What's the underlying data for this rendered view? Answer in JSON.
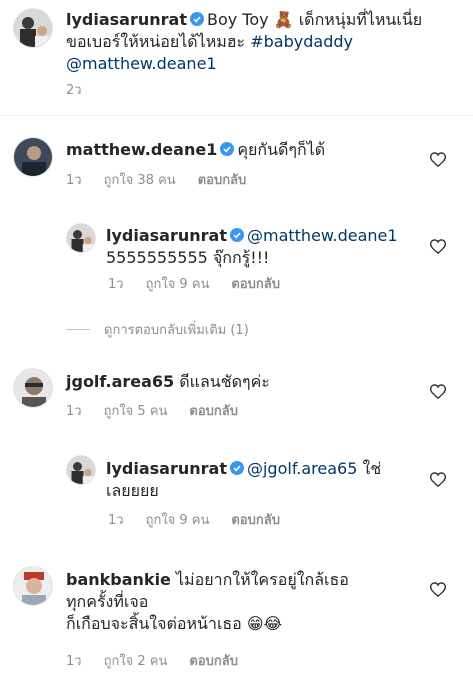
{
  "caption": {
    "username": "lydiasarunrat",
    "text_line1_tail": "Boy Toy 🧸 เด็กหนุ่มที่ไหนเนี่ย",
    "text_line2": "ขอเบอร์ให้หน่อยได้ไหมฮะ",
    "hashtag": "#babydaddy",
    "mention": "@matthew.deane1",
    "time": "2ว"
  },
  "comments": [
    {
      "username": "matthew.deane1",
      "text": "คุยกันดีๆก็ได้",
      "time": "1ว",
      "likes": "ถูกใจ 38 คน",
      "reply_label": "ตอบกลับ"
    },
    {
      "username": "lydiasarunrat",
      "mention": "@matthew.deane1",
      "text": "5555555555 จุ๊กกรู้!!!",
      "time": "1ว",
      "likes": "ถูกใจ 9 คน",
      "reply_label": "ตอบกลับ"
    },
    {
      "more_replies": "ดูการตอบกลับเพิ่มเติม (1)"
    },
    {
      "username": "jgolf.area65",
      "text": "ดีแลนชัดๆค่ะ",
      "time": "1ว",
      "likes": "ถูกใจ 5 คน",
      "reply_label": "ตอบกลับ"
    },
    {
      "username": "lydiasarunrat",
      "mention": "@jgolf.area65",
      "text_tail": "ใช่",
      "text_line2": "เลยยยย",
      "time": "1ว",
      "likes": "ถูกใจ 9 คน",
      "reply_label": "ตอบกลับ"
    },
    {
      "username": "bankbankie",
      "text_line1": "ไม่อยากให้ใครอยู่ใกล้เธอ",
      "text_line2": "ทุกครั้งที่เจอ",
      "text_line3": "ก็เกือบจะสิ้นใจต่อหน้าเธอ",
      "emojis": "😁😂",
      "time": "1ว",
      "likes": "ถูกใจ 2 คน",
      "reply_label": "ตอบกลับ"
    }
  ],
  "colors": {
    "text": "#262626",
    "meta": "#8e8e8e",
    "link": "#00376b",
    "verified": "#3897f0"
  },
  "icons": [
    "verified-badge-icon",
    "heart-outline-icon"
  ]
}
